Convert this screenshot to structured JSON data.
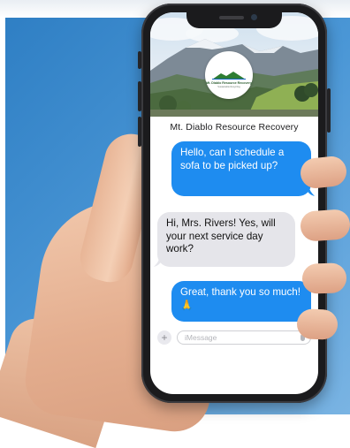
{
  "conversation": {
    "contact_name": "Mt. Diablo Resource Recovery",
    "messages": [
      {
        "from": "me",
        "text": "Hello, can I schedule a sofa to be picked up?"
      },
      {
        "from": "them",
        "text": "Hi, Mrs. Rivers! Yes, will your next service day work?"
      },
      {
        "from": "me",
        "text": "Great, thank you so much! 🙏"
      }
    ]
  },
  "logo": {
    "name": "Mt. Diablo Resource Recovery",
    "tagline": "Sustainable Recycling"
  },
  "composer": {
    "placeholder": "iMessage",
    "plus_label": "+"
  },
  "colors": {
    "sent_bubble": "#1e8cf0",
    "received_bubble": "#e5e5ea",
    "background": "#3d8ad0"
  },
  "icons": [
    "plus-icon",
    "microphone-icon"
  ]
}
